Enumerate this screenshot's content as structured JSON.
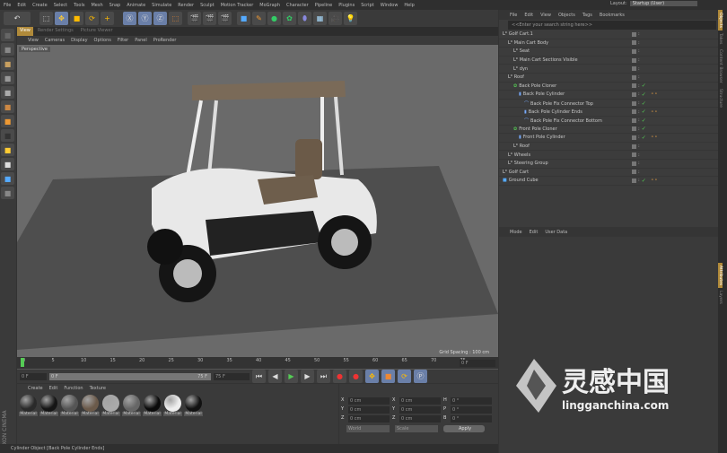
{
  "menu": [
    "File",
    "Edit",
    "Create",
    "Select",
    "Tools",
    "Mesh",
    "Snap",
    "Animate",
    "Simulate",
    "Render",
    "Sculpt",
    "Motion Tracker",
    "MoGraph",
    "Character",
    "Pipeline",
    "Plugins",
    "Script",
    "Window",
    "Help"
  ],
  "layout": {
    "label": "Layout:",
    "value": "Startup (User)"
  },
  "view_tabs": [
    "View",
    "Render Settings",
    "Picture Viewer"
  ],
  "view_menu": [
    "View",
    "Cameras",
    "Display",
    "Options",
    "Filter",
    "Panel",
    "ProRender"
  ],
  "viewport": {
    "label": "Perspective",
    "grid": "Grid Spacing : 100 cm"
  },
  "object_manager": {
    "menu": [
      "File",
      "Edit",
      "View",
      "Objects",
      "Tags",
      "Bookmarks"
    ],
    "search_placeholder": "<<Enter your search string here>>",
    "objects": [
      {
        "name": "Golf Cart.1",
        "depth": 0,
        "icon": "null"
      },
      {
        "name": "Main Cart Body",
        "depth": 1,
        "icon": "null"
      },
      {
        "name": "Seat",
        "depth": 2,
        "icon": "null"
      },
      {
        "name": "Main Cart Sections Visible",
        "depth": 2,
        "icon": "null"
      },
      {
        "name": "dyn",
        "depth": 2,
        "icon": "null"
      },
      {
        "name": "Roof",
        "depth": 1,
        "icon": "null"
      },
      {
        "name": "Back Pole Cloner",
        "depth": 2,
        "icon": "cloner"
      },
      {
        "name": "Back Pole Cylinder",
        "depth": 3,
        "icon": "cylinder"
      },
      {
        "name": "Back Pole Fix Connector Top",
        "depth": 4,
        "icon": "spline"
      },
      {
        "name": "Back Pole Cylinder Ends",
        "depth": 4,
        "icon": "cylinder"
      },
      {
        "name": "Back Pole Fix Connector Bottom",
        "depth": 4,
        "icon": "spline"
      },
      {
        "name": "Front Pole Cloner",
        "depth": 2,
        "icon": "cloner"
      },
      {
        "name": "Front Pole Cylinder",
        "depth": 3,
        "icon": "cylinder"
      },
      {
        "name": "Roof",
        "depth": 2,
        "icon": "null"
      },
      {
        "name": "Wheels",
        "depth": 1,
        "icon": "null"
      },
      {
        "name": "Steering Group",
        "depth": 1,
        "icon": "null"
      },
      {
        "name": "Golf Cart",
        "depth": 0,
        "icon": "null"
      },
      {
        "name": "Ground Cube",
        "depth": 0,
        "icon": "cube"
      }
    ]
  },
  "attributes": {
    "menu": [
      "Mode",
      "Edit",
      "User Data"
    ]
  },
  "right_tabs": [
    "Objects",
    "Takes",
    "Content Browser",
    "Structure",
    "Attributes",
    "Layers"
  ],
  "timeline": {
    "ticks": [
      "0",
      "5",
      "10",
      "15",
      "20",
      "25",
      "30",
      "35",
      "40",
      "45",
      "50",
      "55",
      "60",
      "65",
      "70",
      "75"
    ],
    "current": "0 F",
    "start": "0 F",
    "range_start": "0 F",
    "range_end": "75 F",
    "end": "75 F"
  },
  "materials": {
    "menu": [
      "Create",
      "Edit",
      "Function",
      "Texture"
    ],
    "items": [
      "Material",
      "Material",
      "Material",
      "Material",
      "Material",
      "Material",
      "Material",
      "Material",
      "Material"
    ],
    "colors": [
      "#2a2a2a",
      "#151515",
      "#555",
      "#6b5a4a",
      "#aaa",
      "#666",
      "#0a0a0a",
      "#eee",
      "#111"
    ]
  },
  "coords": {
    "rows": [
      [
        "X",
        "0 cm",
        "X",
        "0 cm",
        "H",
        "0 °"
      ],
      [
        "Y",
        "0 cm",
        "Y",
        "0 cm",
        "P",
        "0 °"
      ],
      [
        "Z",
        "0 cm",
        "Z",
        "0 cm",
        "B",
        "0 °"
      ]
    ],
    "mode1": "World",
    "mode2": "Scale",
    "apply": "Apply"
  },
  "brand": "MAXON CINEMA 4D",
  "status": "Cylinder Object [Back Pole Cylinder Ends]",
  "watermark": {
    "cn": "灵感中国",
    "url": "lingganchina.com"
  }
}
